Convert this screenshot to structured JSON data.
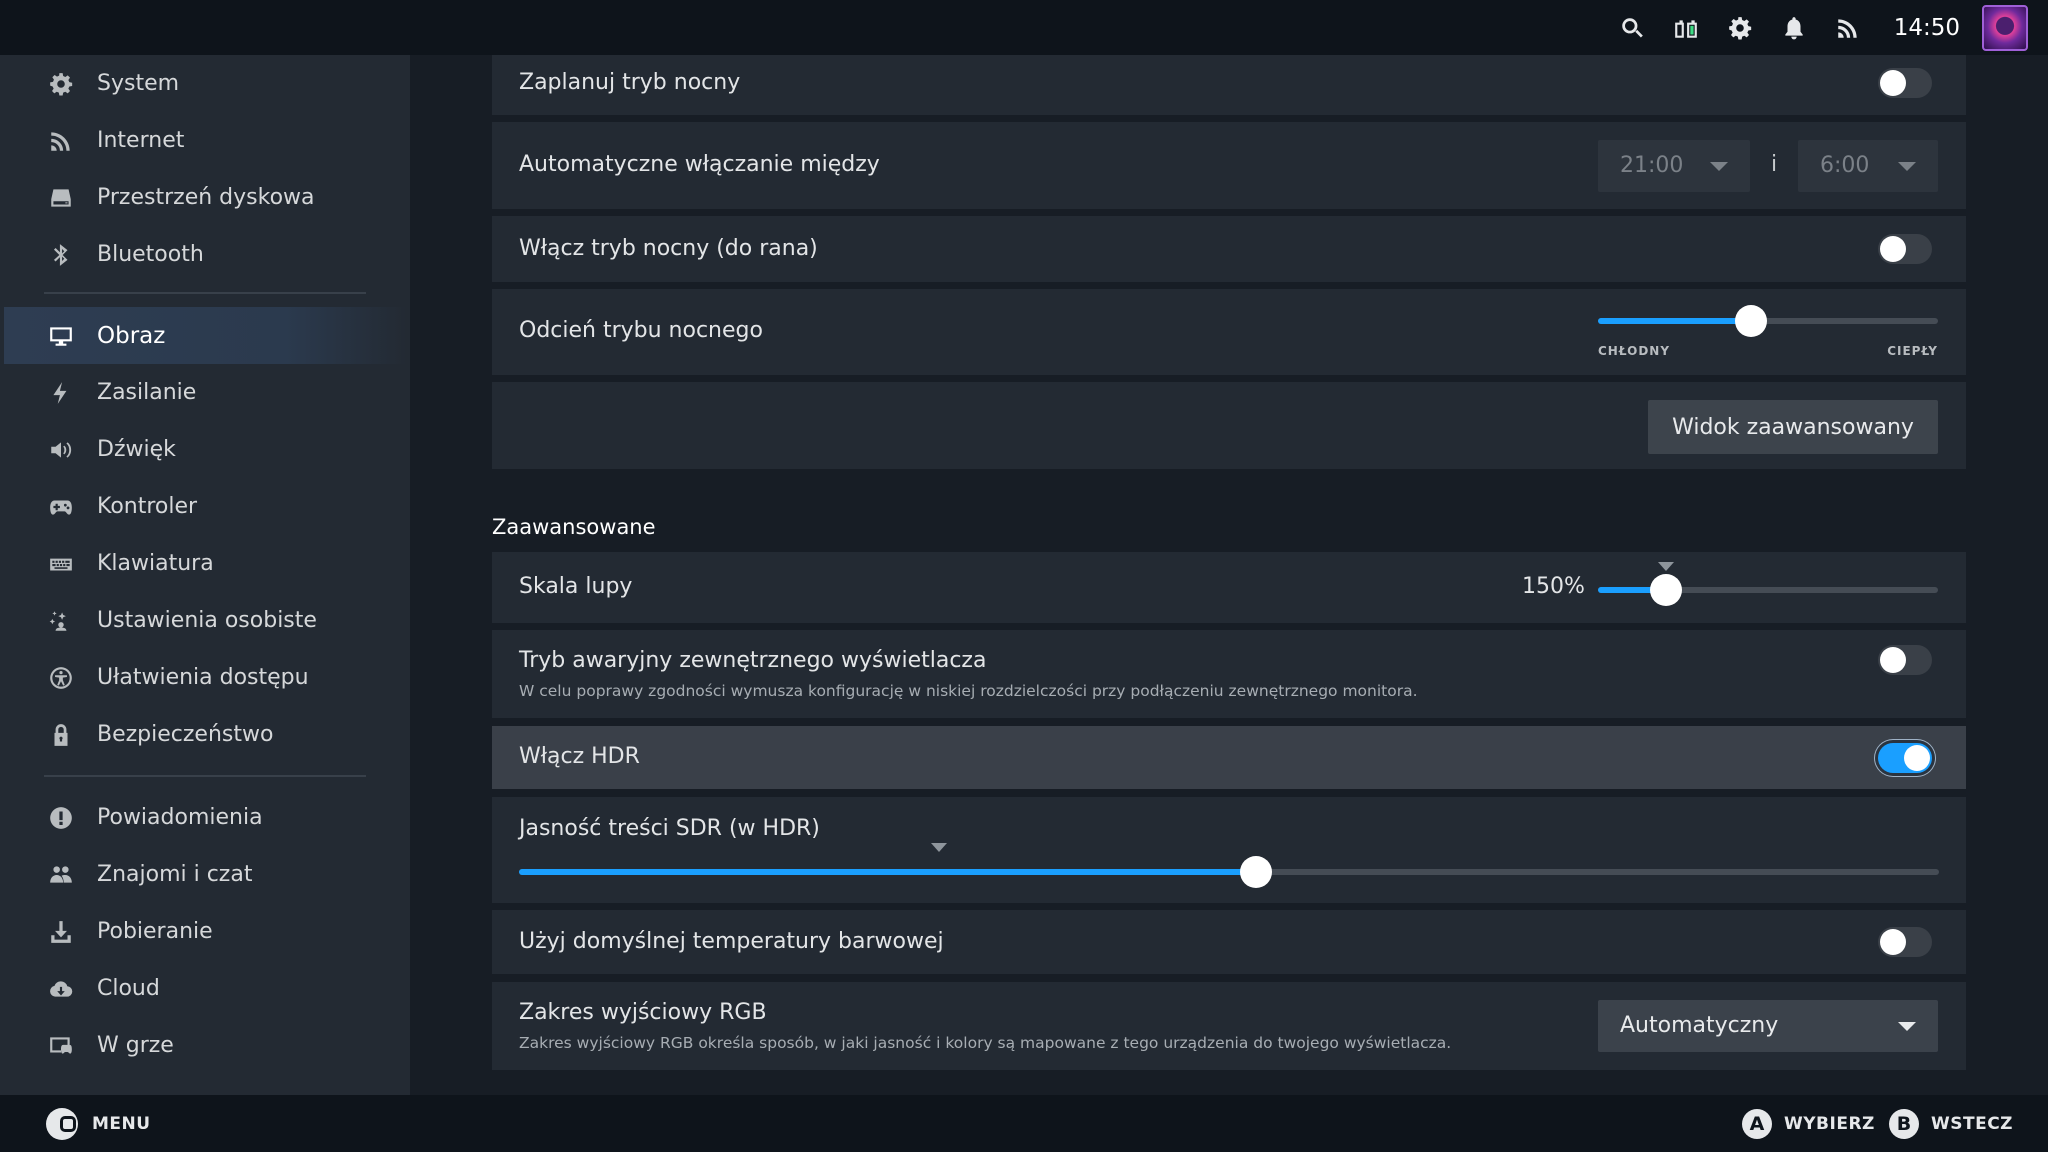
{
  "topbar": {
    "time": "14:50",
    "icons": [
      "search-icon",
      "battery-icon",
      "gear-icon",
      "bell-icon",
      "wifi-icon"
    ]
  },
  "sidebar": {
    "items": [
      {
        "label": "System",
        "icon": "gear-icon"
      },
      {
        "label": "Internet",
        "icon": "wifi-icon"
      },
      {
        "label": "Przestrzeń dyskowa",
        "icon": "storage-icon"
      },
      {
        "label": "Bluetooth",
        "icon": "bluetooth-icon"
      },
      {
        "label": "Obraz",
        "icon": "monitor-icon",
        "active": true
      },
      {
        "label": "Zasilanie",
        "icon": "lightning-icon"
      },
      {
        "label": "Dźwięk",
        "icon": "speaker-icon"
      },
      {
        "label": "Kontroler",
        "icon": "gamepad-icon"
      },
      {
        "label": "Klawiatura",
        "icon": "keyboard-icon"
      },
      {
        "label": "Ustawienia osobiste",
        "icon": "sparkle-person-icon"
      },
      {
        "label": "Ułatwienia dostępu",
        "icon": "accessibility-icon"
      },
      {
        "label": "Bezpieczeństwo",
        "icon": "lock-icon"
      },
      {
        "label": "Powiadomienia",
        "icon": "alert-icon"
      },
      {
        "label": "Znajomi i czat",
        "icon": "friends-icon"
      },
      {
        "label": "Pobieranie",
        "icon": "download-icon"
      },
      {
        "label": "Cloud",
        "icon": "cloud-icon"
      },
      {
        "label": "W grze",
        "icon": "ingame-icon"
      }
    ]
  },
  "main": {
    "night_schedule": {
      "label": "Zaplanuj tryb nocny",
      "on": false
    },
    "auto_between": {
      "label": "Automatyczne włączanie między",
      "from": "21:00",
      "and": "i",
      "to": "6:00"
    },
    "night_until_morning": {
      "label": "Włącz tryb nocny (do rana)",
      "on": false
    },
    "night_tint": {
      "label": "Odcień trybu nocnego",
      "min_label": "CHŁODNY",
      "max_label": "CIEPŁY",
      "value": 0.45
    },
    "advanced_view_button": "Widok zaawansowany",
    "section_advanced": "Zaawansowane",
    "magnifier": {
      "label": "Skala lupy",
      "value_text": "150%",
      "value": 0.2,
      "default": 0.2
    },
    "external_failsafe": {
      "label": "Tryb awaryjny zewnętrznego wyświetlacza",
      "desc": "W celu poprawy zgodności wymusza konfigurację w niskiej rozdzielczości przy podłączeniu zewnętrznego monitora.",
      "on": false
    },
    "hdr": {
      "label": "Włącz HDR",
      "on": true
    },
    "sdr_brightness": {
      "label": "Jasność treści SDR (w HDR)",
      "value": 0.519,
      "default": 0.296
    },
    "default_color_temp": {
      "label": "Użyj domyślnej temperatury barwowej",
      "on": false
    },
    "rgb_range": {
      "label": "Zakres wyjściowy RGB",
      "desc": "Zakres wyjściowy RGB określa sposób, w jaki jasność i kolory są mapowane z tego urządzenia do twojego wyświetlacza.",
      "value": "Automatyczny"
    }
  },
  "bottombar": {
    "menu_label": "MENU",
    "a_glyph": "A",
    "a_label": "WYBIERZ",
    "b_glyph": "B",
    "b_label": "WSTECZ"
  },
  "colors": {
    "accent": "#1a9fff",
    "background": "#171d25",
    "panel": "#232a33",
    "topbar": "#0e141b"
  }
}
